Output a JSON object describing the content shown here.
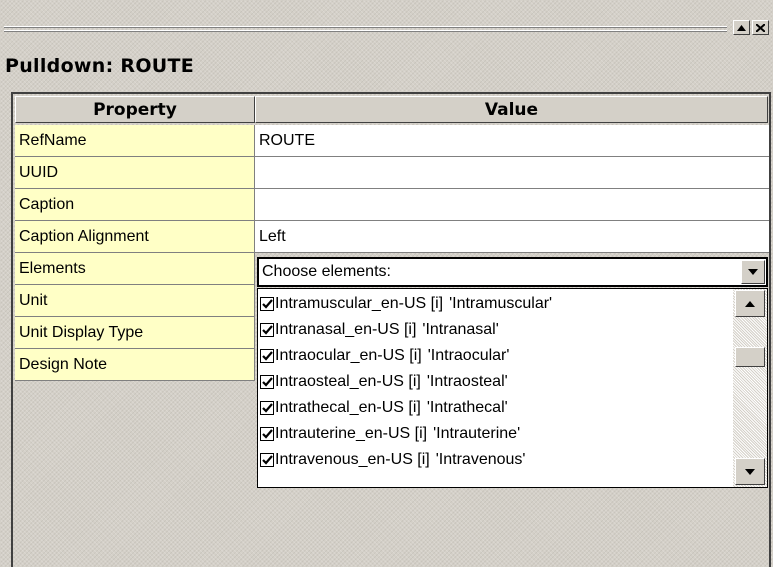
{
  "window": {
    "heading": "Pulldown: ROUTE",
    "buttons": {
      "up_icon": "triangle-up-icon",
      "close_icon": "close-icon"
    }
  },
  "grid": {
    "headers": {
      "property": "Property",
      "value": "Value"
    },
    "rows": [
      {
        "property": "RefName",
        "value": "ROUTE"
      },
      {
        "property": "UUID",
        "value": ""
      },
      {
        "property": "Caption",
        "value": ""
      },
      {
        "property": "Caption Alignment",
        "value": "Left"
      },
      {
        "property": "Elements",
        "value": ""
      },
      {
        "property": "Unit",
        "value": ""
      },
      {
        "property": "Unit Display Type",
        "value": ""
      },
      {
        "property": "Design Note",
        "value": ""
      }
    ]
  },
  "elements_dropdown": {
    "prompt": "Choose elements:",
    "items": [
      {
        "name": "Intramuscular_en-US [i]",
        "label": "'Intramuscular'",
        "checked": true
      },
      {
        "name": "Intranasal_en-US [i]",
        "label": "'Intranasal'",
        "checked": true
      },
      {
        "name": "Intraocular_en-US [i]",
        "label": "'Intraocular'",
        "checked": true
      },
      {
        "name": "Intraosteal_en-US [i]",
        "label": "'Intraosteal'",
        "checked": true
      },
      {
        "name": "Intrathecal_en-US [i]",
        "label": "'Intrathecal'",
        "checked": true
      },
      {
        "name": "Intrauterine_en-US [i]",
        "label": "'Intrauterine'",
        "checked": true
      },
      {
        "name": "Intravenous_en-US [i]",
        "label": "'Intravenous'",
        "checked": true
      }
    ],
    "scroll_position": 0.4
  },
  "colors": {
    "property_cell_bg": "#ffffc6",
    "panel_bg": "#d4d0c8",
    "value_cell_bg": "#ffffff"
  }
}
